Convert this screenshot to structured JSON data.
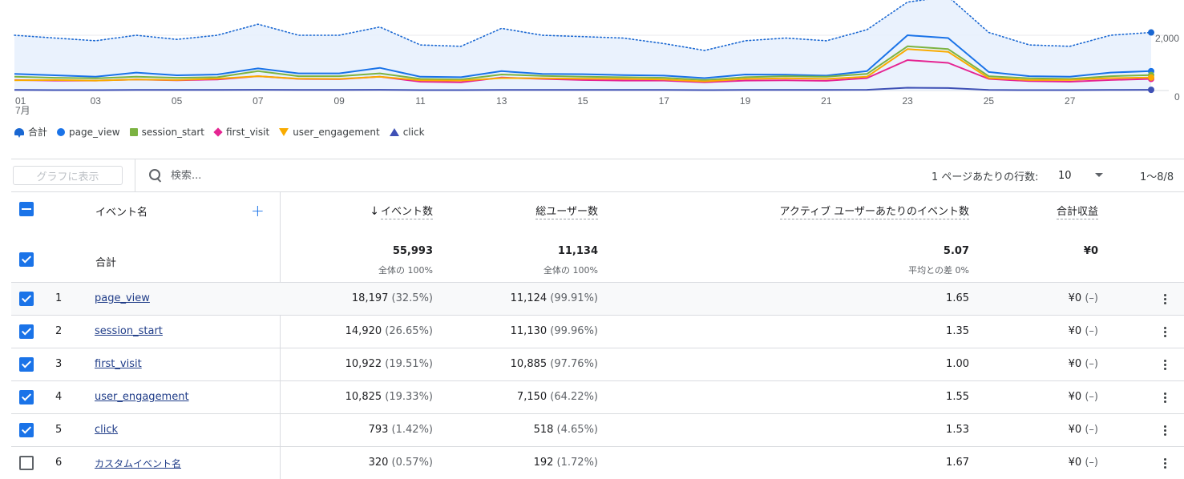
{
  "chart_data": {
    "type": "line",
    "x_tick_labels": [
      "01",
      "03",
      "05",
      "07",
      "09",
      "11",
      "13",
      "15",
      "17",
      "19",
      "21",
      "23",
      "25",
      "27"
    ],
    "x_month_label": "7月",
    "y_tick_labels": [
      "2,000",
      "0"
    ],
    "x": [
      1,
      2,
      3,
      4,
      5,
      6,
      7,
      8,
      9,
      10,
      11,
      12,
      13,
      14,
      15,
      16,
      17,
      18,
      19,
      20,
      21,
      22,
      23,
      24,
      25,
      26,
      27,
      28,
      29
    ],
    "series": [
      {
        "name": "合計",
        "color": "#1967d2",
        "style": "dotted-area",
        "values": [
          2000,
          1900,
          1800,
          2000,
          1850,
          2000,
          2400,
          2000,
          2000,
          2300,
          1650,
          1600,
          2250,
          2000,
          1950,
          1900,
          1700,
          1450,
          1800,
          1900,
          1800,
          2200,
          3200,
          3400,
          2100,
          1650,
          1600,
          2000,
          2100
        ]
      },
      {
        "name": "page_view",
        "color": "#1a73e8",
        "values": [
          600,
          550,
          500,
          650,
          550,
          580,
          800,
          620,
          620,
          820,
          500,
          480,
          700,
          600,
          590,
          560,
          540,
          450,
          580,
          570,
          540,
          700,
          2000,
          1900,
          670,
          520,
          500,
          650,
          700
        ]
      },
      {
        "name": "session_start",
        "color": "#7cb342",
        "values": [
          500,
          460,
          440,
          500,
          460,
          480,
          700,
          520,
          520,
          620,
          420,
          400,
          580,
          530,
          500,
          480,
          460,
          380,
          480,
          520,
          500,
          600,
          1600,
          1500,
          520,
          440,
          420,
          520,
          560
        ]
      },
      {
        "name": "first_visit",
        "color": "#e52592",
        "values": [
          380,
          360,
          360,
          400,
          370,
          400,
          520,
          420,
          410,
          500,
          320,
          300,
          470,
          420,
          380,
          360,
          360,
          300,
          360,
          370,
          350,
          450,
          1100,
          1000,
          420,
          340,
          320,
          380,
          420
        ]
      },
      {
        "name": "user_engagement",
        "color": "#f9ab00",
        "values": [
          370,
          380,
          360,
          400,
          380,
          430,
          520,
          430,
          420,
          500,
          370,
          360,
          450,
          440,
          430,
          420,
          400,
          330,
          420,
          440,
          420,
          500,
          1500,
          1400,
          450,
          380,
          380,
          450,
          470
        ]
      },
      {
        "name": "click",
        "color": "#3f51b5",
        "values": [
          20,
          15,
          15,
          20,
          20,
          20,
          25,
          20,
          20,
          25,
          15,
          15,
          20,
          20,
          20,
          20,
          20,
          15,
          20,
          20,
          20,
          25,
          100,
          90,
          20,
          15,
          15,
          20,
          25
        ]
      }
    ]
  },
  "legend": {
    "items": [
      {
        "label": "合計",
        "shape": "drop",
        "color": "#1967d2"
      },
      {
        "label": "page_view",
        "shape": "dot",
        "color": "#1a73e8"
      },
      {
        "label": "session_start",
        "shape": "square",
        "color": "#7cb342"
      },
      {
        "label": "first_visit",
        "shape": "diamond",
        "color": "#e52592"
      },
      {
        "label": "user_engagement",
        "shape": "triangle-down",
        "color": "#f9ab00"
      },
      {
        "label": "click",
        "shape": "triangle-up",
        "color": "#3f51b5"
      }
    ]
  },
  "toolbar": {
    "graph_button": "グラフに表示",
    "search_placeholder": "検索...",
    "rows_per_page_label": "1 ページあたりの行数:",
    "rows_per_page_value": "10",
    "pager": "1〜8/8"
  },
  "table": {
    "headers": {
      "event_name": "イベント名",
      "event_count": "イベント数",
      "total_users": "総ユーザー数",
      "events_per_active_user": "アクティブ ユーザーあたりのイベント数",
      "total_revenue": "合計収益"
    },
    "totals": {
      "label": "合計",
      "event_count": "55,993",
      "event_count_sub": "全体の 100%",
      "total_users": "11,134",
      "total_users_sub": "全体の 100%",
      "events_per_active_user": "5.07",
      "events_per_active_user_sub": "平均との差 0%",
      "total_revenue": "¥0"
    },
    "rows": [
      {
        "rank": "1",
        "name": "page_view",
        "checked": true,
        "event_count": "18,197",
        "event_count_pct": "(32.5%)",
        "total_users": "11,124",
        "total_users_pct": "(99.91%)",
        "per_user": "1.65",
        "revenue": "¥0",
        "revenue_pct": "(–)"
      },
      {
        "rank": "2",
        "name": "session_start",
        "checked": true,
        "event_count": "14,920",
        "event_count_pct": "(26.65%)",
        "total_users": "11,130",
        "total_users_pct": "(99.96%)",
        "per_user": "1.35",
        "revenue": "¥0",
        "revenue_pct": "(–)"
      },
      {
        "rank": "3",
        "name": "first_visit",
        "checked": true,
        "event_count": "10,922",
        "event_count_pct": "(19.51%)",
        "total_users": "10,885",
        "total_users_pct": "(97.76%)",
        "per_user": "1.00",
        "revenue": "¥0",
        "revenue_pct": "(–)"
      },
      {
        "rank": "4",
        "name": "user_engagement",
        "checked": true,
        "event_count": "10,825",
        "event_count_pct": "(19.33%)",
        "total_users": "7,150",
        "total_users_pct": "(64.22%)",
        "per_user": "1.55",
        "revenue": "¥0",
        "revenue_pct": "(–)"
      },
      {
        "rank": "5",
        "name": "click",
        "checked": true,
        "event_count": "793",
        "event_count_pct": "(1.42%)",
        "total_users": "518",
        "total_users_pct": "(4.65%)",
        "per_user": "1.53",
        "revenue": "¥0",
        "revenue_pct": "(–)"
      },
      {
        "rank": "6",
        "name": "カスタムイベント名",
        "checked": false,
        "event_count": "320",
        "event_count_pct": "(0.57%)",
        "total_users": "192",
        "total_users_pct": "(1.72%)",
        "per_user": "1.67",
        "revenue": "¥0",
        "revenue_pct": "(–)"
      }
    ]
  }
}
